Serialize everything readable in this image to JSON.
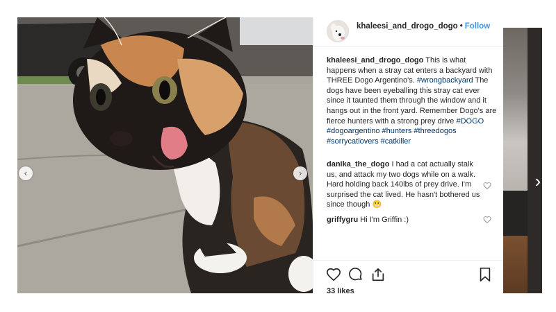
{
  "post": {
    "username": "khaleesi_and_drogo_dogo",
    "separator": "•",
    "follow_label": "Follow",
    "caption_text_1": "This is what happens when a stray cat enters a backyard with THREE Dogo Argentino's.",
    "caption_tag_1": "#wrongbackyard",
    "caption_text_2": "The dogs have been eyeballing this stray cat ever since it taunted them through the window and it hangs out in the front yard. Remember Dogo's are fierce hunters with a strong prey drive",
    "caption_tags": [
      "#DOGO",
      "#dogoargentino",
      "#hunters",
      "#threedogos",
      "#sorrycatlovers",
      "#catkiller"
    ],
    "likes": "33 likes"
  },
  "comments": [
    {
      "user": "danika_the_dogo",
      "text": "I had a cat actually stalk us, and attack my two dogs while on a walk. Hard holding back 140lbs of prey drive. I'm surprised the cat lived. He hasn't bothered us since though",
      "emoji": "😬"
    },
    {
      "user": "griffygru",
      "text": "Hi I'm Griffin :)"
    }
  ],
  "navigation": {
    "prev_glyph": "‹",
    "next_glyph": "›",
    "next_post_glyph": "›"
  },
  "icons": [
    "heart-icon",
    "comment-icon",
    "share-icon",
    "bookmark-icon",
    "chevron-left-icon",
    "chevron-right-icon"
  ],
  "colors": {
    "follow": "#3897f0",
    "hashtag": "#003569",
    "text": "#262626",
    "border": "#efefef"
  }
}
